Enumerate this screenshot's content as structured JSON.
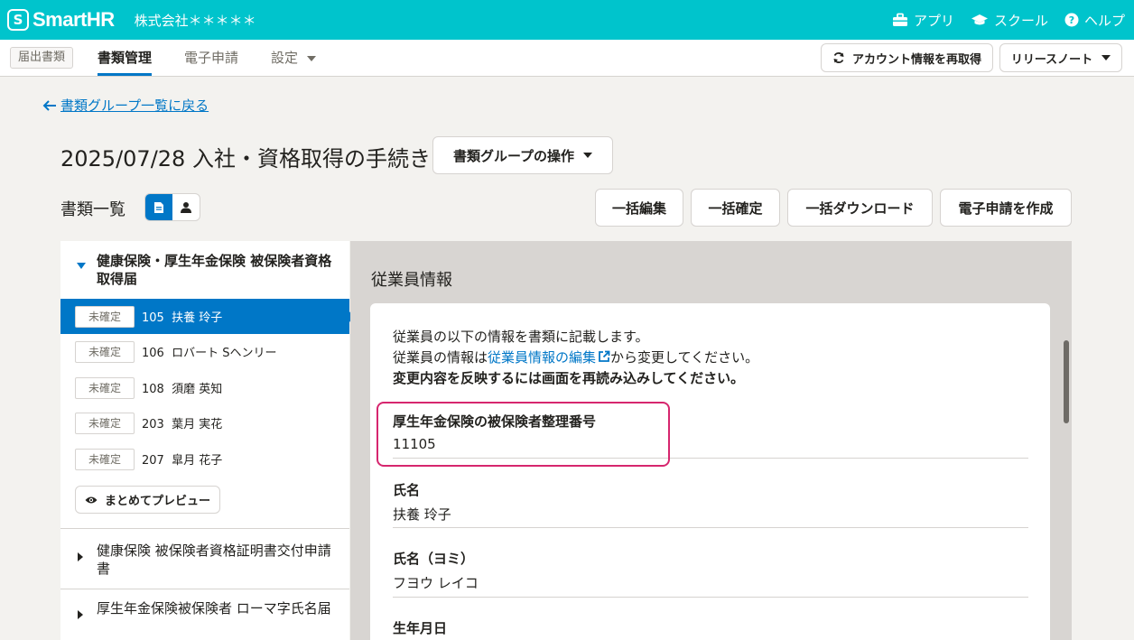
{
  "header": {
    "logo_mark": "S",
    "logo_text": "SmartHR",
    "company": "株式会社＊＊＊＊＊",
    "links": [
      {
        "label": "アプリ",
        "icon": "toolbox-icon"
      },
      {
        "label": "スクール",
        "icon": "graduation-cap-icon"
      },
      {
        "label": "ヘルプ",
        "icon": "help-circle-icon"
      }
    ]
  },
  "subnav": {
    "chip": "届出書類",
    "tabs": [
      {
        "label": "書類管理",
        "active": true
      },
      {
        "label": "電子申請",
        "active": false
      },
      {
        "label": "設定",
        "active": false
      }
    ],
    "refresh_button": "アカウント情報を再取得",
    "release_notes": "リリースノート"
  },
  "page": {
    "back_link": "書類グループ一覧に戻る",
    "title": "2025/07/28 入社・資格取得の手続き",
    "group_ops": "書類グループの操作",
    "list_title": "書類一覧",
    "actions": [
      "一括編集",
      "一括確定",
      "一括ダウンロード",
      "電子申請を作成"
    ]
  },
  "sidebar": {
    "open_group": "健康保険・厚生年金保険 被保険者資格取得届",
    "items": [
      {
        "status": "未確定",
        "label": "105  扶養 玲子",
        "selected": true
      },
      {
        "status": "未確定",
        "label": "106  ロバート Sヘンリー",
        "selected": false
      },
      {
        "status": "未確定",
        "label": "108  須磨 英知",
        "selected": false
      },
      {
        "status": "未確定",
        "label": "203  葉月 実花",
        "selected": false
      },
      {
        "status": "未確定",
        "label": "207  皐月 花子",
        "selected": false
      }
    ],
    "preview_button": "まとめてプレビュー",
    "other_groups": [
      "健康保険 被保険者資格証明書交付申請書",
      "厚生年金保険被保険者 ローマ字氏名届"
    ]
  },
  "main": {
    "title": "従業員情報",
    "intro_line1": "従業員の以下の情報を書類に記載します。",
    "intro_line2_prefix": "従業員の情報は",
    "intro_link": "従業員情報の編集",
    "intro_line2_suffix": "から変更してください。",
    "intro_line3": "変更内容を反映するには画面を再読み込みしてください。",
    "fields": [
      {
        "label": "厚生年金保険の被保険者整理番号",
        "value": "11105"
      },
      {
        "label": "氏名",
        "value": "扶養 玲子"
      },
      {
        "label": "氏名（ヨミ）",
        "value": "フヨウ レイコ"
      },
      {
        "label": "生年月日",
        "value": ""
      }
    ]
  },
  "colors": {
    "header": "#00c4cc",
    "primary": "#0077c7",
    "highlight": "#d6266e"
  }
}
